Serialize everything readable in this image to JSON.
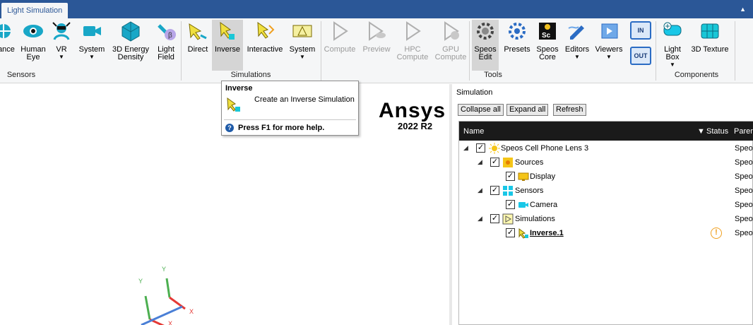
{
  "window": {
    "tab_label": "Light Simulation"
  },
  "ribbon": {
    "sensors": {
      "group_label": "Sensors",
      "buttons": [
        "ance",
        "Human Eye",
        "VR",
        "System",
        "3D Energy Density",
        "Light Field"
      ]
    },
    "simulations": {
      "group_label": "Simulations",
      "buttons": [
        "Direct",
        "Inverse",
        "Interactive",
        "System"
      ]
    },
    "compute": {
      "buttons": [
        "Compute",
        "Preview",
        "HPC Compute",
        "GPU Compute"
      ]
    },
    "tools": {
      "group_label": "Tools",
      "buttons": [
        "Speos Edit",
        "Presets",
        "Speos Core",
        "Editors",
        "Viewers"
      ],
      "in_label": "IN",
      "out_label": "OUT"
    },
    "components": {
      "group_label": "Components",
      "buttons": [
        "Light Box",
        "3D Texture"
      ]
    }
  },
  "tooltip": {
    "title": "Inverse",
    "description": "Create an Inverse Simulation",
    "help": "Press F1 for more help."
  },
  "viewport": {
    "logo": "Ansys",
    "version": "2022 R2",
    "axis_labels": [
      "Y",
      "Y",
      "X",
      "X"
    ]
  },
  "simulation_panel": {
    "title": "Simulation",
    "buttons": {
      "collapse": "Collapse all",
      "expand": "Expand all",
      "refresh": "Refresh"
    },
    "columns": {
      "name": "Name",
      "status": "Status",
      "parent": "Parent"
    },
    "rows": [
      {
        "label": "Speos Cell Phone Lens 3",
        "parent": "Speos",
        "icon": "sun-icon"
      },
      {
        "label": "Sources",
        "parent": "Speos",
        "icon": "sources-icon"
      },
      {
        "label": "Display",
        "parent": "Speos",
        "icon": "display-icon"
      },
      {
        "label": "Sensors",
        "parent": "Speos",
        "icon": "sensor-cross-icon"
      },
      {
        "label": "Camera",
        "parent": "Speos",
        "icon": "camera-icon"
      },
      {
        "label": "Simulations",
        "parent": "Speos",
        "icon": "play-icon"
      },
      {
        "label": "Inverse.1",
        "parent": "Speos",
        "icon": "inverse-sim-icon",
        "status": "!"
      }
    ]
  },
  "colors": {
    "titlebar": "#2b5797",
    "ribbon_bg": "#f5f6f7",
    "tree_header": "#1a1a1a",
    "warning": "#f0a020"
  }
}
